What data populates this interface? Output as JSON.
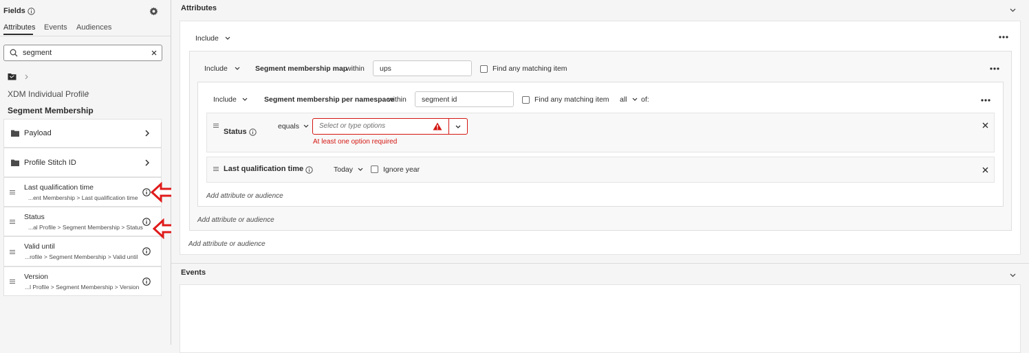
{
  "sidebar": {
    "title": "Fields",
    "tabs": [
      {
        "label": "Attributes",
        "active": true
      },
      {
        "label": "Events",
        "active": false
      },
      {
        "label": "Audiences",
        "active": false
      }
    ],
    "search": {
      "value": "segment",
      "placeholder": ""
    },
    "breadcrumb_root": "XDM Individual Profile",
    "section_title": "Segment Membership",
    "folders": [
      {
        "label": "Payload",
        "icon": "folder-icon"
      },
      {
        "label": "Profile Stitch ID",
        "icon": "folder-icon"
      }
    ],
    "fields": [
      {
        "label": "Last qualification time",
        "path": "...ent Membership > Last qualification time"
      },
      {
        "label": "Status",
        "path": "...al Profile > Segment Membership > Status"
      },
      {
        "label": "Valid until",
        "path": "...rofile > Segment Membership > Valid until"
      },
      {
        "label": "Version",
        "path": "...l Profile > Segment Membership > Version"
      }
    ]
  },
  "attributes": {
    "title": "Attributes",
    "outer": {
      "include": "Include",
      "add_label": "Add attribute or audience"
    },
    "map": {
      "include": "Include",
      "name": "Segment membership map",
      "within": "within",
      "value": "ups",
      "find_any": "Find any matching item",
      "add_label": "Add attribute or audience"
    },
    "namespace": {
      "include": "Include",
      "name": "Segment membership per namespace",
      "within": "within",
      "value": "segment id",
      "find_any": "Find any matching item",
      "quantifier": "all",
      "of": "of:",
      "add_label": "Add attribute or audience"
    },
    "status_rule": {
      "name": "Status",
      "operator": "equals",
      "placeholder": "Select or type options",
      "error": "At least one option required"
    },
    "lqt_rule": {
      "name": "Last qualification time",
      "operator": "Today",
      "ignore_year": "Ignore year"
    }
  },
  "events": {
    "title": "Events"
  },
  "colors": {
    "error": "#d31510",
    "annotation_arrow": "#e01b1b"
  }
}
